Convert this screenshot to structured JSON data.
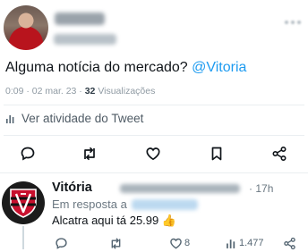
{
  "main_tweet": {
    "text_before_mention": "Alguma notícia do mercado? ",
    "mention": "@Vitoria",
    "time": "0:09 · 02 mar. 23 · ",
    "views_count": "32",
    "views_label": " Visualizações",
    "activity_label": "Ver atividade do Tweet"
  },
  "reply": {
    "author_name": "Vitória",
    "dot": "·",
    "time": "17h",
    "replying_to_label": "Em resposta a",
    "text": "Alcatra aqui tá 25.99 👍",
    "likes": "8",
    "views": "1.477"
  },
  "colors": {
    "accent": "#1d9bf0",
    "text": "#0f1419",
    "muted": "#536471"
  }
}
